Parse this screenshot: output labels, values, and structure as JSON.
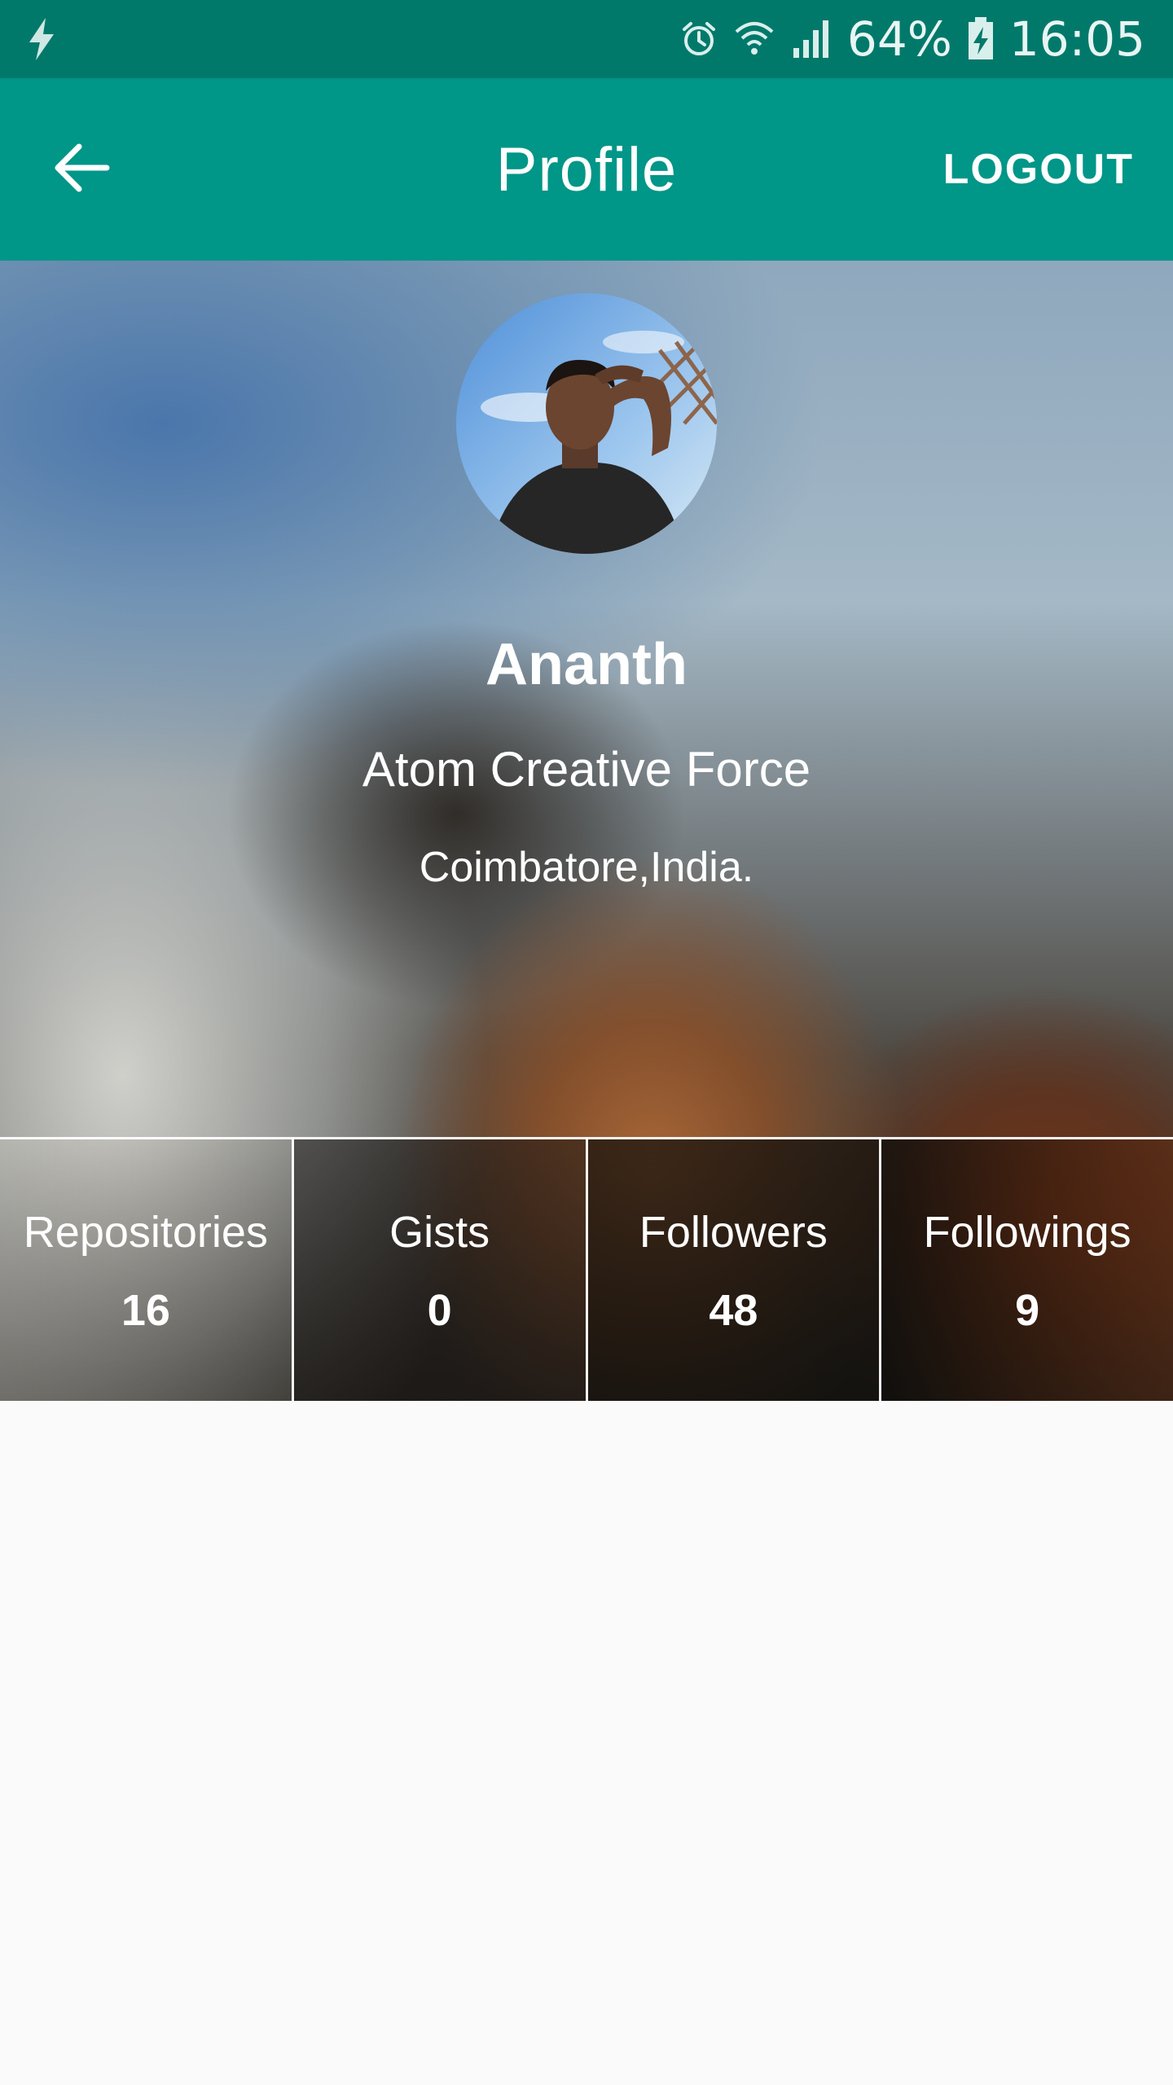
{
  "status_bar": {
    "battery": "64%",
    "time": "16:05",
    "icons": [
      "charging-bolt-icon",
      "alarm-icon",
      "wifi-icon",
      "signal-icon",
      "battery-charging-icon"
    ]
  },
  "app_bar": {
    "title": "Profile",
    "logout_label": "LOGOUT",
    "back_icon": "arrow-left-icon"
  },
  "profile": {
    "name": "Ananth",
    "company": "Atom Creative Force",
    "location": "Coimbatore,India.",
    "avatar_icon": "profile-photo"
  },
  "stats": [
    {
      "label": "Repositories",
      "value": "16"
    },
    {
      "label": "Gists",
      "value": "0"
    },
    {
      "label": "Followers",
      "value": "48"
    },
    {
      "label": "Followings",
      "value": "9"
    }
  ],
  "colors": {
    "status_bar": "#00796b",
    "app_bar": "#009688",
    "background": "#fafafa"
  }
}
